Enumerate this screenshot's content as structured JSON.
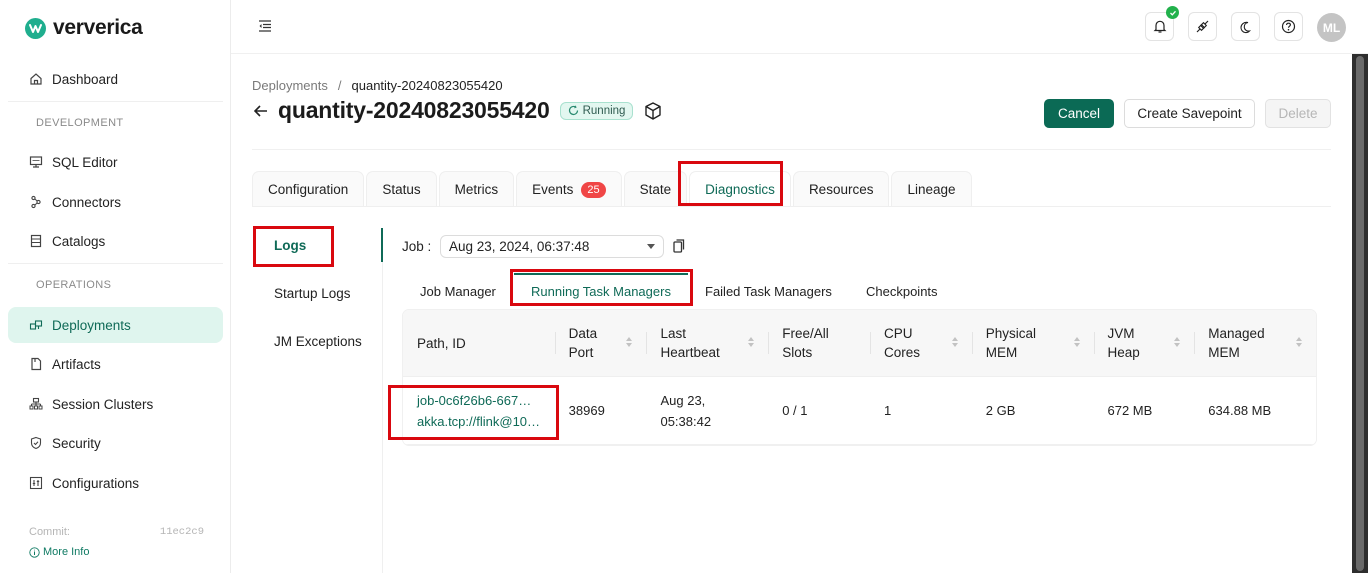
{
  "brand": {
    "name": "ververica",
    "color": "#1fae8e"
  },
  "sidebar": {
    "dashboard": "Dashboard",
    "sections": [
      {
        "label": "DEVELOPMENT",
        "items": [
          {
            "label": "SQL Editor",
            "icon": "sql-editor-icon"
          },
          {
            "label": "Connectors",
            "icon": "connectors-icon"
          },
          {
            "label": "Catalogs",
            "icon": "catalogs-icon"
          }
        ]
      },
      {
        "label": "OPERATIONS",
        "items": [
          {
            "label": "Deployments",
            "icon": "deployments-icon",
            "active": true
          },
          {
            "label": "Artifacts",
            "icon": "artifacts-icon"
          },
          {
            "label": "Session Clusters",
            "icon": "session-clusters-icon"
          },
          {
            "label": "Security",
            "icon": "security-icon"
          },
          {
            "label": "Configurations",
            "icon": "configurations-icon"
          }
        ]
      }
    ],
    "commit_label": "Commit:",
    "commit_hash": "11ec2c9",
    "more_info": "More Info"
  },
  "topbar": {
    "avatar_initials": "ML",
    "icons": [
      "bell-icon",
      "plugin-icon",
      "moon-icon",
      "help-icon"
    ]
  },
  "header": {
    "breadcrumb": {
      "parent": "Deployments",
      "separator": "/",
      "current": "quantity-20240823055420"
    },
    "title": "quantity-20240823055420",
    "status": "Running",
    "buttons": {
      "cancel": "Cancel",
      "savepoint": "Create Savepoint",
      "delete": "Delete"
    }
  },
  "tabs": [
    {
      "label": "Configuration"
    },
    {
      "label": "Status"
    },
    {
      "label": "Metrics"
    },
    {
      "label": "Events",
      "badge": "25"
    },
    {
      "label": "State"
    },
    {
      "label": "Diagnostics",
      "active": true
    },
    {
      "label": "Resources"
    },
    {
      "label": "Lineage"
    }
  ],
  "diagnostics": {
    "subnav": [
      {
        "label": "Logs",
        "active": true
      },
      {
        "label": "Startup Logs"
      },
      {
        "label": "JM Exceptions"
      }
    ],
    "job_label": "Job :",
    "job_value": "Aug 23, 2024, 06:37:48",
    "subtabs": [
      {
        "label": "Job Manager"
      },
      {
        "label": "Running Task Managers",
        "active": true
      },
      {
        "label": "Failed Task Managers"
      },
      {
        "label": "Checkpoints"
      }
    ],
    "table": {
      "headers": [
        [
          "Path, ID"
        ],
        [
          "Data",
          "Port"
        ],
        [
          "Last",
          "Heartbeat"
        ],
        [
          "Free/All",
          "Slots"
        ],
        [
          "CPU",
          "Cores"
        ],
        [
          "Physical",
          "MEM"
        ],
        [
          "JVM",
          "Heap"
        ],
        [
          "Managed",
          "MEM"
        ]
      ],
      "rows": [
        {
          "path": "job-0c6f26b6-667…",
          "id": "akka.tcp://flink@10…",
          "data_port": "38969",
          "heartbeat_date": "Aug 23,",
          "heartbeat_time": "05:38:42",
          "slots": "0 / 1",
          "cpu_cores": "1",
          "physical_mem": "2 GB",
          "jvm_heap": "672 MB",
          "managed_mem": "634.88 MB"
        }
      ]
    }
  },
  "colors": {
    "accent": "#0f6a57",
    "highlight": "#d9080f",
    "badge": "#f04646"
  }
}
